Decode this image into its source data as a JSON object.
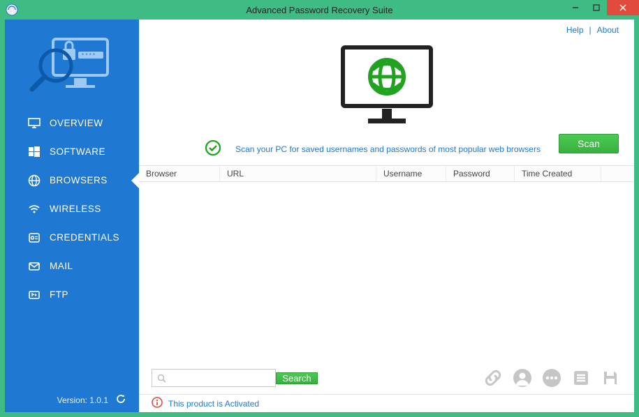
{
  "titlebar": {
    "title": "Advanced Password Recovery Suite"
  },
  "sidebar": {
    "items": [
      {
        "label": "OVERVIEW"
      },
      {
        "label": "SOFTWARE"
      },
      {
        "label": "BROWSERS"
      },
      {
        "label": "WIRELESS"
      },
      {
        "label": "CREDENTIALS"
      },
      {
        "label": "MAIL"
      },
      {
        "label": "FTP"
      }
    ],
    "version_label": "Version: 1.0.1"
  },
  "header_links": {
    "help": "Help",
    "about": "About"
  },
  "scan": {
    "message": "Scan your PC for saved usernames and passwords of most popular web browsers",
    "button": "Scan"
  },
  "table": {
    "columns": [
      "Browser",
      "URL",
      "Username",
      "Password",
      "Time Created"
    ]
  },
  "search": {
    "placeholder": "",
    "button": "Search",
    "value": ""
  },
  "status": {
    "text": "This product is Activated"
  }
}
